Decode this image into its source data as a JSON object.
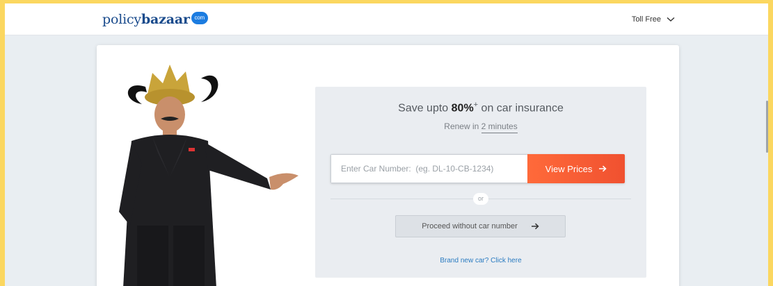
{
  "header": {
    "logo_part1": "policy",
    "logo_part2": "bazaar",
    "logo_badge": "com",
    "toll_free": "Toll Free"
  },
  "hero": {
    "headline_prefix": "Save upto ",
    "headline_value": "80%",
    "headline_sup": "+",
    "headline_suffix": " on car insurance",
    "sub_prefix": "Renew in ",
    "sub_value": "2 minutes"
  },
  "form": {
    "car_number_placeholder": "Enter Car Number:  (eg. DL-10-CB-1234)",
    "view_prices_label": "View Prices",
    "or_label": "or",
    "proceed_label": "Proceed without car number",
    "brand_new_link": "Brand new car? Click here"
  },
  "icons": {
    "arrow": "arrow-right-icon",
    "chevron": "chevron-down-icon"
  },
  "colors": {
    "accent": "#f05130",
    "brand": "#1a4b8c",
    "link": "#2a7bc1"
  }
}
